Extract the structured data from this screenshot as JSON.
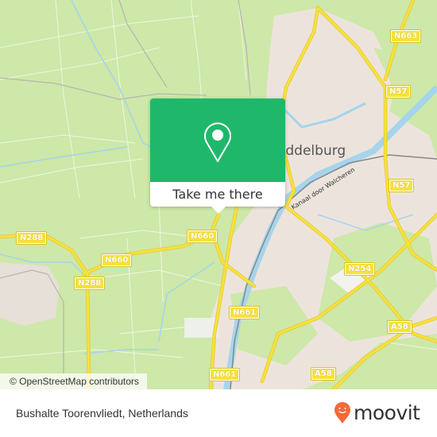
{
  "map": {
    "city_label": "Middelburg",
    "canal_label": "Kanaal door Walcheren",
    "road_shields": [
      "N663",
      "N57",
      "N57",
      "N288",
      "N660",
      "N660",
      "N254",
      "N288",
      "N661",
      "A58",
      "N661",
      "A58"
    ],
    "attribution": "© OpenStreetMap contributors",
    "colors": {
      "land": "#cde8a8",
      "urban": "#ece4dc",
      "water": "#a6d4ec",
      "road": "#f7e13d"
    }
  },
  "popup": {
    "icon": "location-pin-icon",
    "action_label": "Take me there",
    "color": "#1fb86b"
  },
  "footer": {
    "place_name": "Bushalte Toorenvliedt, Netherlands",
    "brand": "moovit",
    "brand_color": "#f26b3a"
  }
}
